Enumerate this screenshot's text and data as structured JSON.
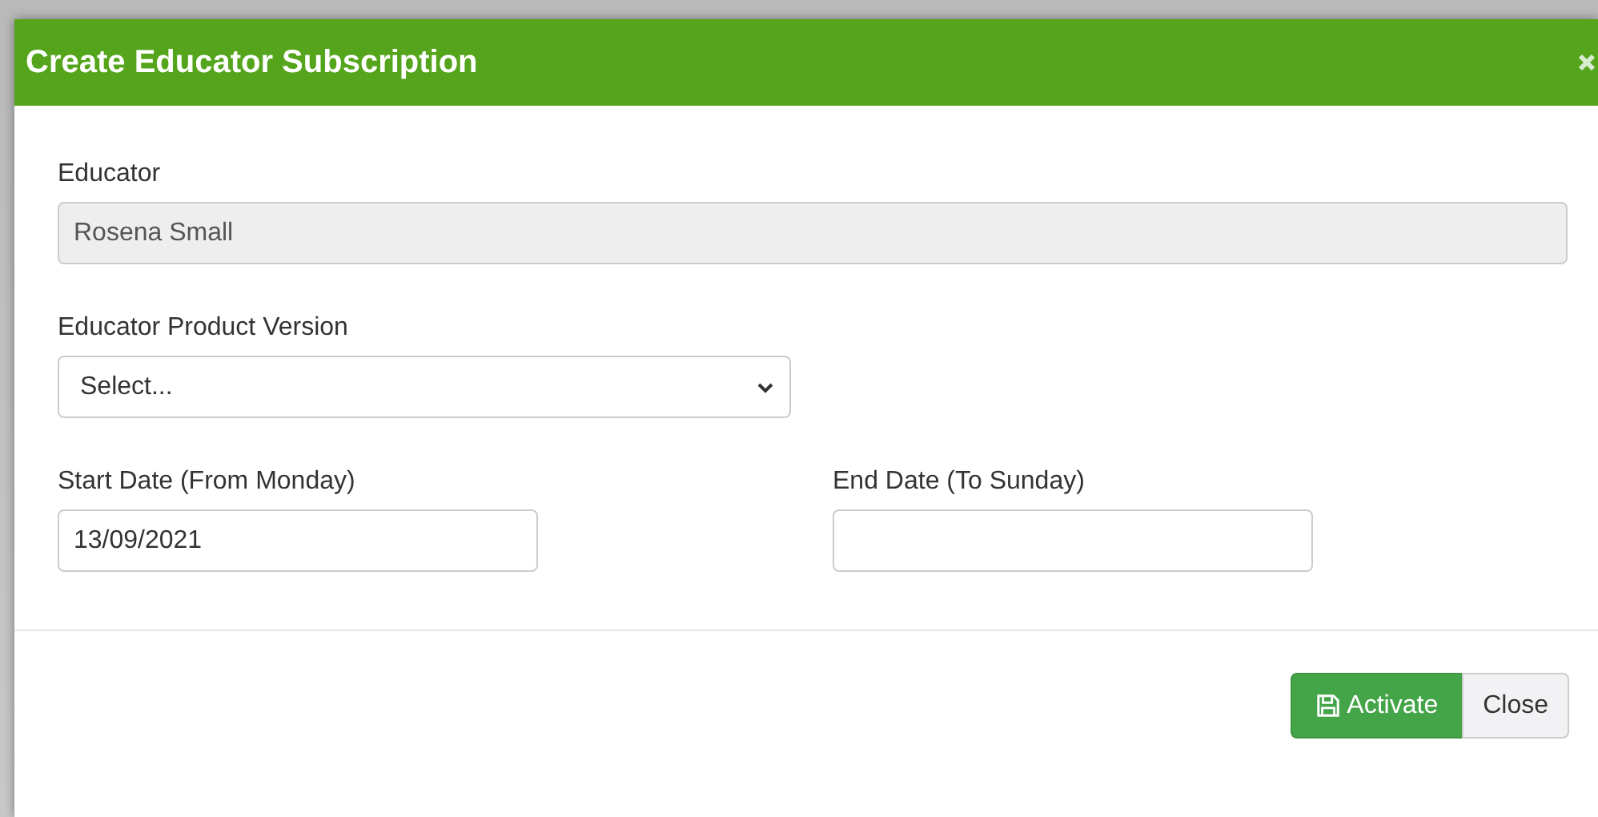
{
  "dialog": {
    "title": "Create Educator Subscription",
    "fields": [
      {
        "kind": "text",
        "label": "Educator",
        "value": "Rosena Small",
        "disabled": true
      },
      {
        "kind": "select",
        "label": "Educator Product Version",
        "value": "Select...",
        "disabled": false
      },
      {
        "kind": "text",
        "label": "Start Date (From Monday)",
        "value": "13/09/2021",
        "disabled": false
      },
      {
        "kind": "text",
        "label": "End Date (To Sunday)",
        "disabled": false
      }
    ],
    "buttons": [
      {
        "label": "Activate",
        "kind": "primary"
      },
      {
        "label": "Close",
        "kind": "default"
      }
    ]
  }
}
